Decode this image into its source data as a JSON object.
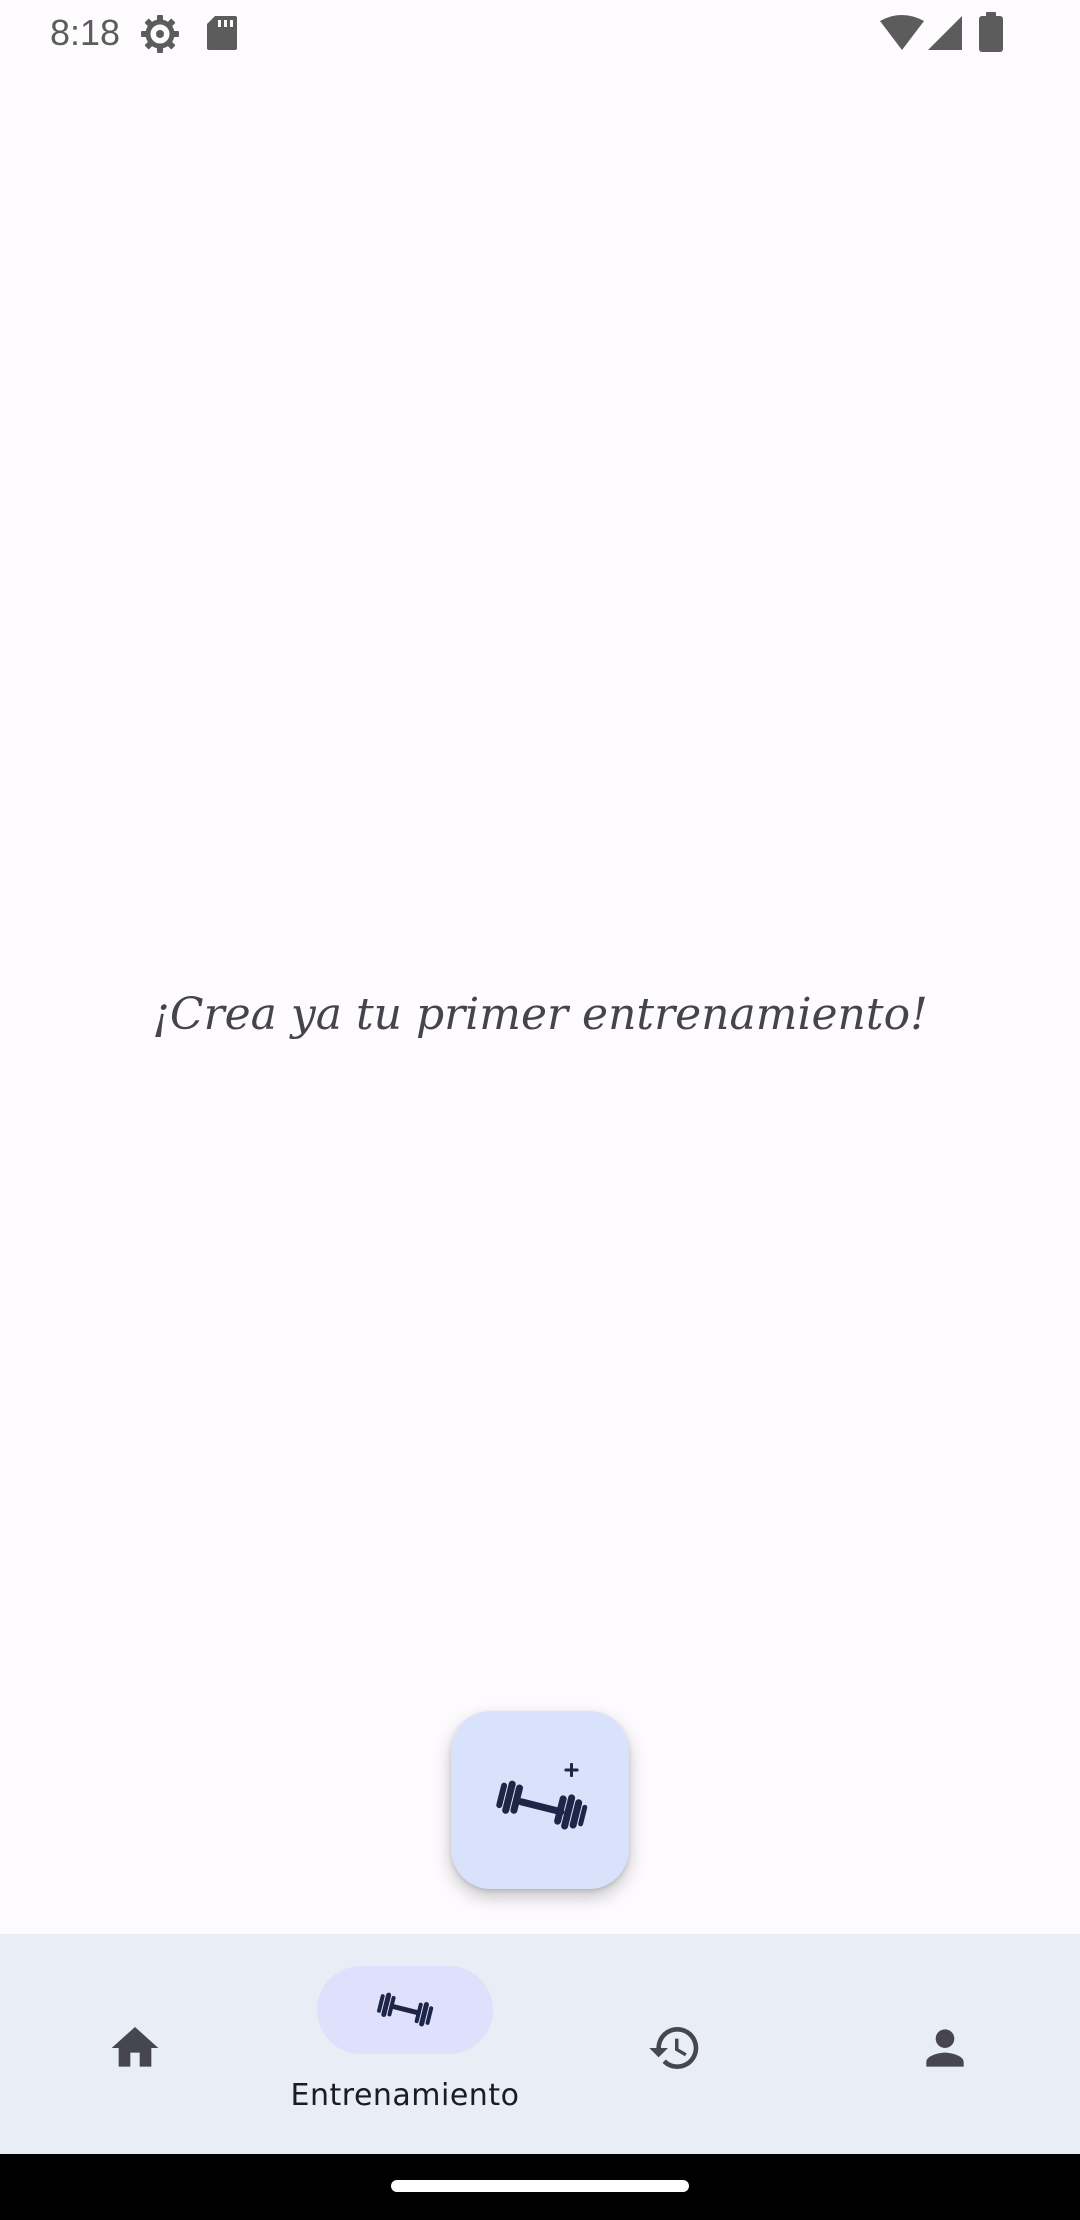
{
  "status_bar": {
    "time": "8:18",
    "icons": [
      "gear-icon",
      "sd-card-icon",
      "wifi-icon",
      "cell-signal-icon",
      "battery-icon"
    ]
  },
  "main": {
    "empty_message": "¡Crea ya tu primer entrenamiento!"
  },
  "fab": {
    "icon": "add-dumbbell-icon",
    "color": "#d9e2fb"
  },
  "bottom_nav": {
    "background": "#e9edf5",
    "items": [
      {
        "id": "home",
        "icon": "home-icon",
        "label": "",
        "selected": false
      },
      {
        "id": "training",
        "icon": "dumbbell-icon",
        "label": "Entrenamiento",
        "selected": true
      },
      {
        "id": "history",
        "icon": "history-icon",
        "label": "",
        "selected": false
      },
      {
        "id": "profile",
        "icon": "person-icon",
        "label": "",
        "selected": false
      }
    ],
    "selected_indicator_color": "#dfe0fb"
  },
  "colors": {
    "background": "#fdfbfd",
    "icon": "#45464f",
    "accent_dark": "#1f2546"
  }
}
